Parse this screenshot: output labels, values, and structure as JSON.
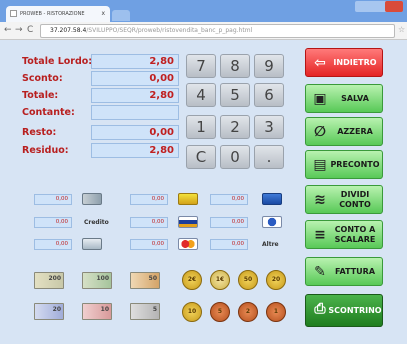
{
  "browser": {
    "tab_title": "PROWEB - RISTORAZIONE",
    "tab_close": "x",
    "url_host": "37.207.58.4",
    "url_path": "/SVILUPPO/SEQR/proweb/ristovendita_banc_p_pag.html",
    "back_glyph": "←",
    "forward_glyph": "→",
    "reload_glyph": "C",
    "star_glyph": "☆"
  },
  "totals": [
    {
      "label": "Totale Lordo:",
      "value": "2,80"
    },
    {
      "label": "Sconto:",
      "value": "0,00"
    },
    {
      "label": "Totale:",
      "value": "2,80"
    },
    {
      "label": "Contante:",
      "value": ""
    },
    {
      "label": "Resto:",
      "value": "0,00"
    },
    {
      "label": "Residuo:",
      "value": "2,80"
    }
  ],
  "keypad": [
    "7",
    "8",
    "9",
    "4",
    "5",
    "6",
    "1",
    "2",
    "3",
    "C",
    "0",
    "."
  ],
  "actions": [
    {
      "label": "INDIETRO",
      "icon": "back-arrow-icon",
      "glyph": "⇦"
    },
    {
      "label": "SALVA",
      "icon": "save-icon",
      "glyph": "▣"
    },
    {
      "label": "AZZERA",
      "icon": "reset-icon",
      "glyph": "∅"
    },
    {
      "label": "PRECONTO",
      "icon": "receipt-icon",
      "glyph": "▤"
    },
    {
      "label": "DIVIDI CONTO",
      "icon": "coins-stack-icon",
      "glyph": "≋"
    },
    {
      "label": "CONTO A SCALARE",
      "icon": "coins-icon",
      "glyph": "≡"
    },
    {
      "label": "FATTURA",
      "icon": "invoice-icon",
      "glyph": "✎"
    },
    {
      "label": "SCONTRINO",
      "icon": "cash-register-icon",
      "glyph": "⎙"
    }
  ],
  "payments": {
    "values": [
      "0,00",
      "0,00",
      "0,00",
      "0,00",
      "0,00",
      "0,00",
      "0,00",
      "0,00",
      "0,00"
    ],
    "credit_label": "Credito",
    "other_label": "Altre"
  },
  "banknotes": [
    "200",
    "100",
    "50",
    "20",
    "10",
    "5"
  ],
  "coins": [
    "2€",
    "1€",
    "50",
    "20",
    "10",
    "5",
    "2",
    "1"
  ]
}
